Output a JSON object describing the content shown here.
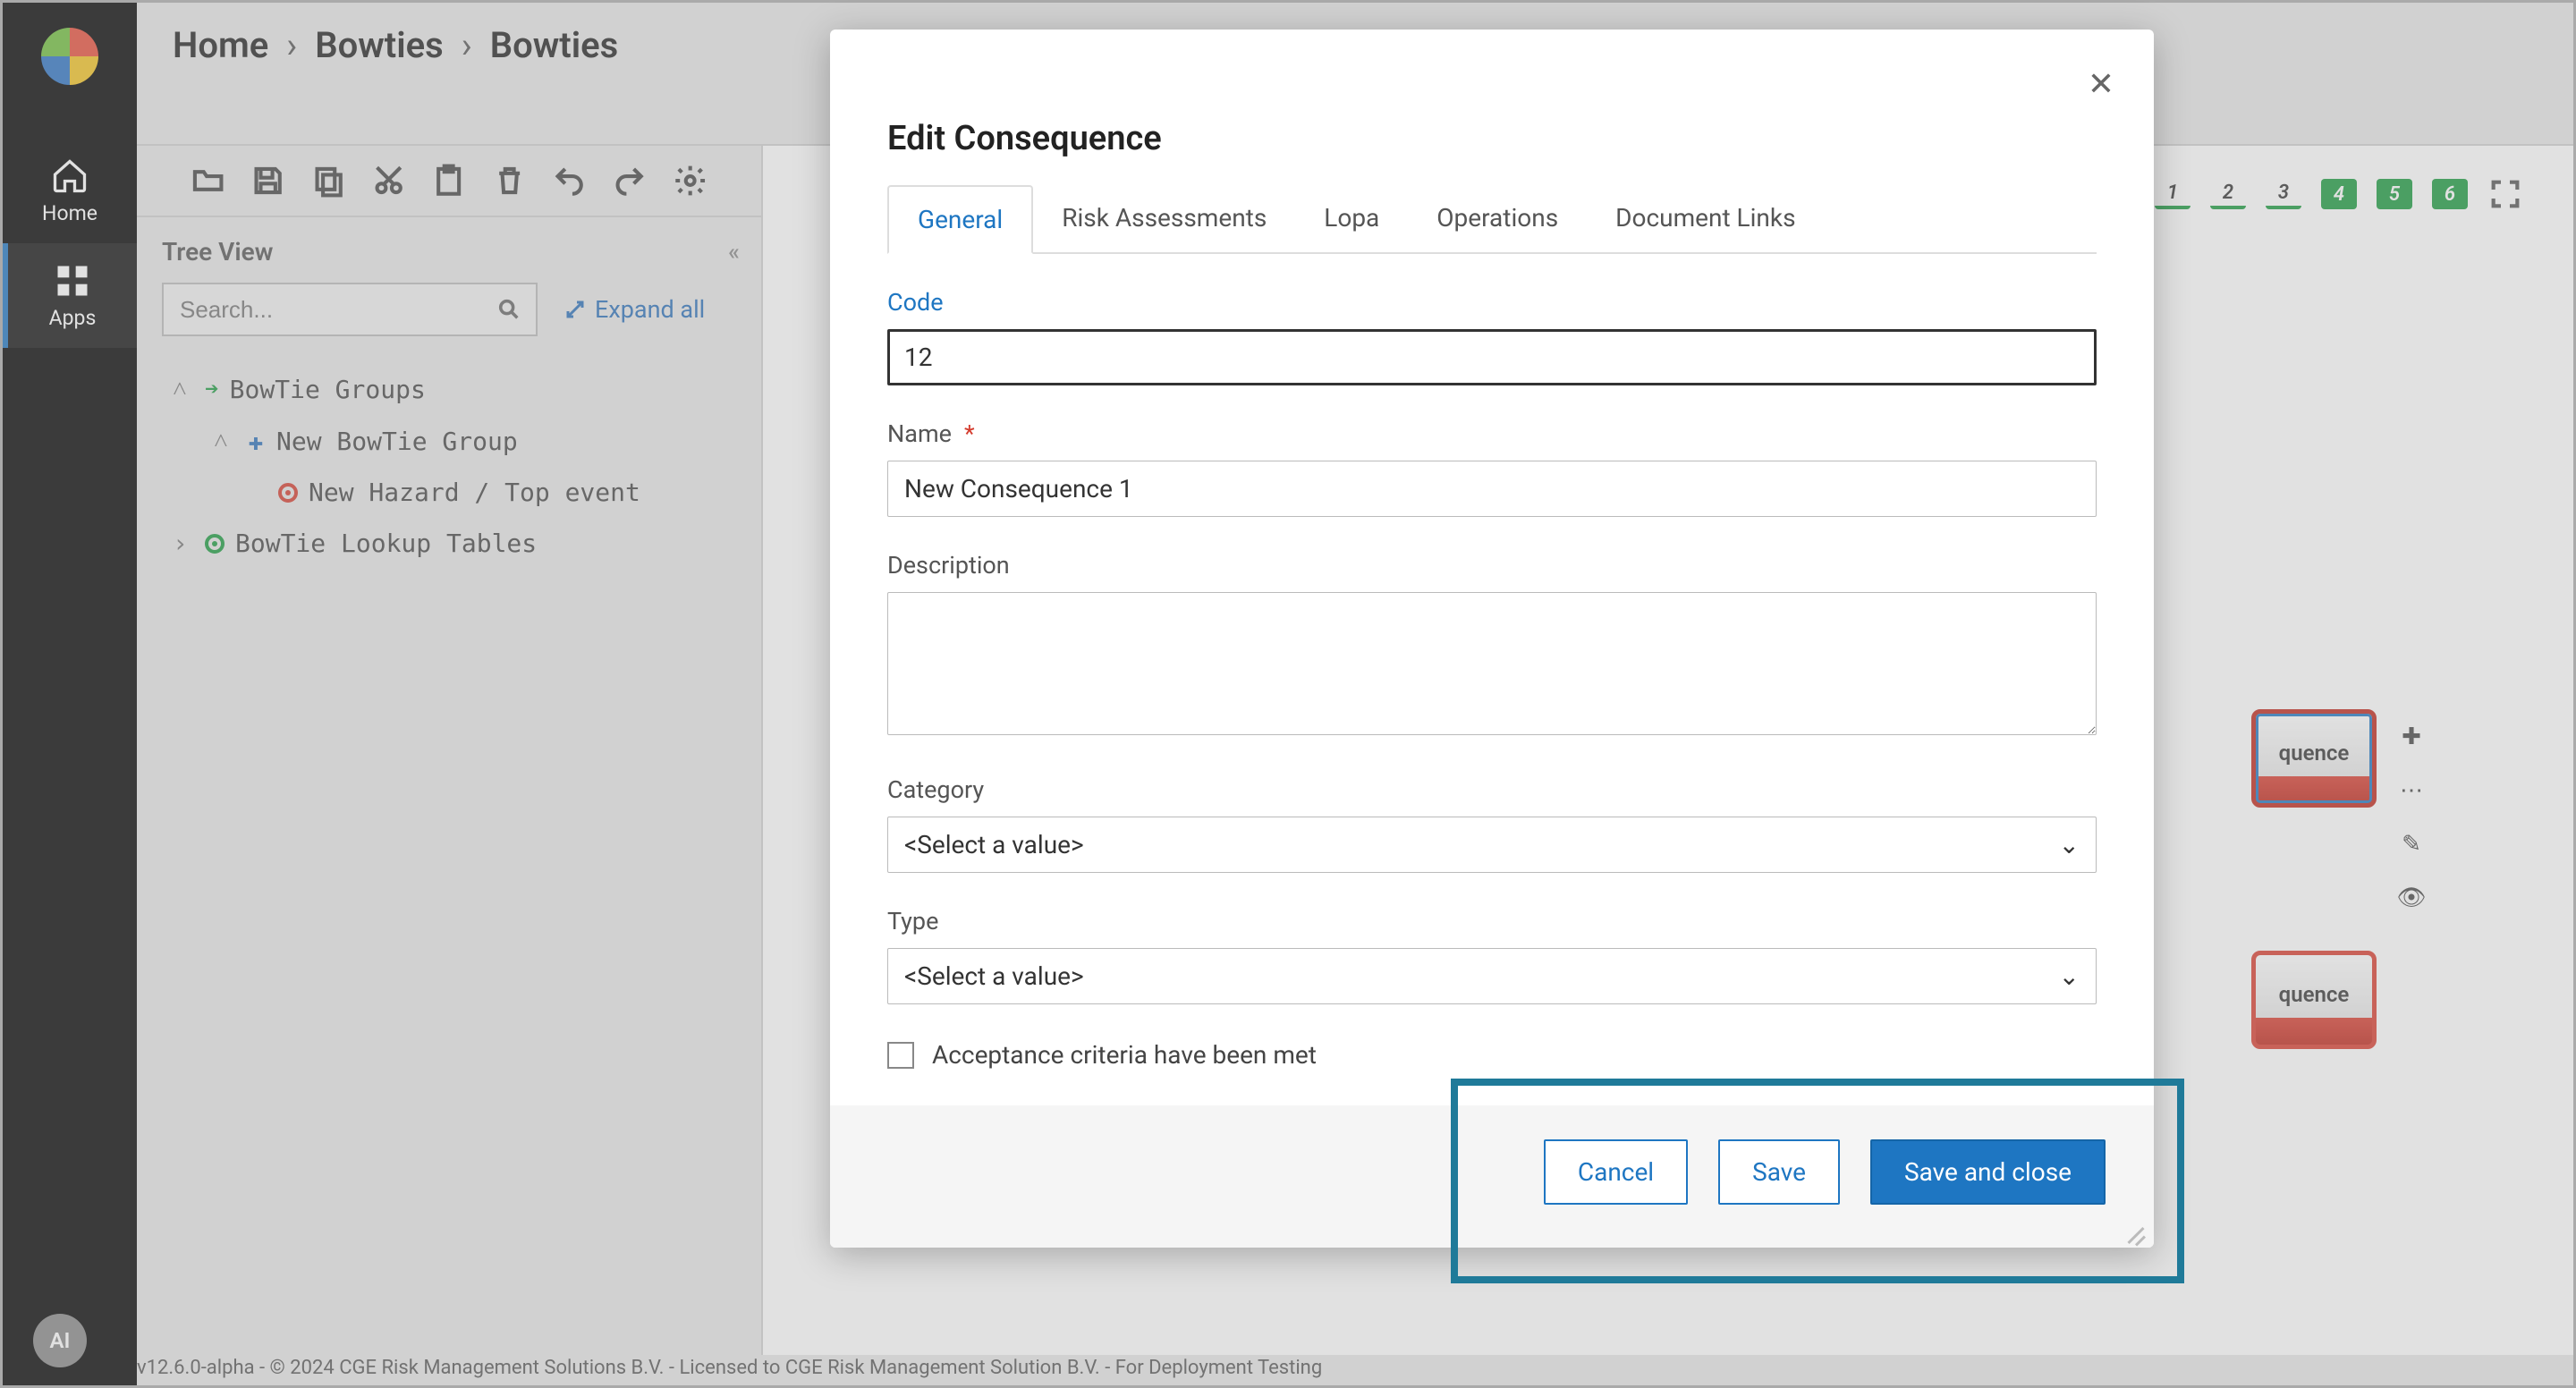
{
  "breadcrumb": [
    "Home",
    "Bowties",
    "Bowties"
  ],
  "rail": {
    "home": "Home",
    "apps": "Apps"
  },
  "side": {
    "title": "Tree View",
    "search_placeholder": "Search...",
    "expand_all": "Expand all",
    "tree": {
      "groups": "BowTie Groups",
      "new_group": "New BowTie Group",
      "hazard": "New Hazard / Top event",
      "lookups": "BowTie Lookup Tables"
    }
  },
  "badges": [
    "1",
    "2",
    "3",
    "4",
    "5",
    "6"
  ],
  "node_label": "quence",
  "modal": {
    "title": "Edit Consequence",
    "tabs": [
      "General",
      "Risk Assessments",
      "Lopa",
      "Operations",
      "Document Links"
    ],
    "fields": {
      "code_label": "Code",
      "code_value": "12",
      "name_label": "Name",
      "name_value": "New Consequence 1",
      "desc_label": "Description",
      "desc_value": "",
      "category_label": "Category",
      "category_value": "<Select a value>",
      "type_label": "Type",
      "type_value": "<Select a value>",
      "acceptance_label": "Acceptance criteria have been met"
    },
    "buttons": {
      "cancel": "Cancel",
      "save": "Save",
      "save_close": "Save and close"
    }
  },
  "footer": "v12.6.0-alpha - © 2024 CGE Risk Management Solutions B.V. - Licensed to CGE Risk Management Solution B.V. - For Deployment Testing",
  "ai_badge": "AI"
}
